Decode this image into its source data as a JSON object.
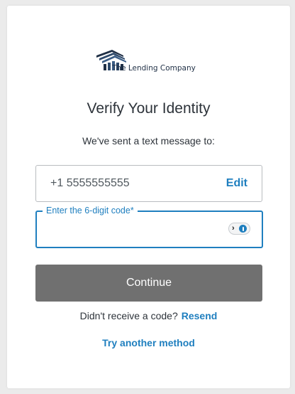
{
  "brand": {
    "logo_icon": "lending-house-icon",
    "name": "The Lending Company"
  },
  "heading": {
    "title": "Verify Your Identity",
    "subtitle": "We've sent a text message to:"
  },
  "phone": {
    "value": "+1 5555555555",
    "edit_label": "Edit"
  },
  "code_field": {
    "label": "Enter the 6-digit code*",
    "value": "",
    "autofill_icon": "password-manager-icon"
  },
  "actions": {
    "continue_label": "Continue",
    "resend_prompt": "Didn't receive a code?",
    "resend_label": "Resend",
    "another_method_label": "Try another method"
  },
  "colors": {
    "accent": "#1f7fbf",
    "button": "#707070",
    "text": "#2d333a"
  }
}
